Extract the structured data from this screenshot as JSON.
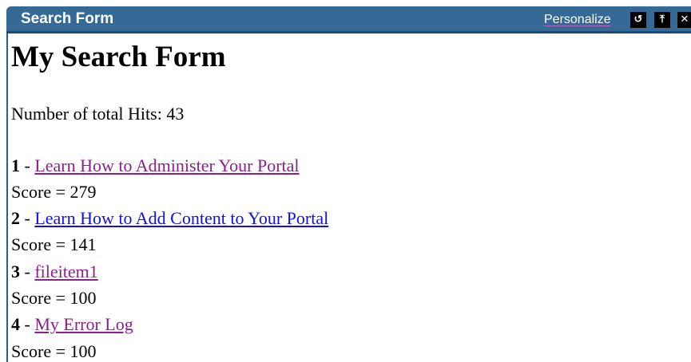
{
  "portlet": {
    "title": "Search Form",
    "personalize_label": "Personalize",
    "controls": {
      "refresh_icon": "refresh-icon",
      "minimize_icon": "minimize-icon",
      "close_icon": "close-icon"
    }
  },
  "main": {
    "heading": "My Search Form",
    "hits_label": "Number of total Hits:",
    "hits_count": "43"
  },
  "results": [
    {
      "num": "1",
      "separator": " - ",
      "title": "Learn How to Administer Your Portal",
      "score_text": "Score = 279",
      "visited": true
    },
    {
      "num": "2",
      "separator": " - ",
      "title": "Learn How to Add Content to Your Portal",
      "score_text": "Score = 141",
      "visited": false
    },
    {
      "num": "3",
      "separator": " - ",
      "title": "fileitem1",
      "score_text": "Score = 100",
      "visited": true
    },
    {
      "num": "4",
      "separator": " - ",
      "title": "My Error Log",
      "score_text": "Score = 100",
      "visited": true
    }
  ],
  "colors": {
    "titlebar": "#356a96",
    "link_visited": "#8b1f8b",
    "link_unvisited": "#1010e6"
  }
}
